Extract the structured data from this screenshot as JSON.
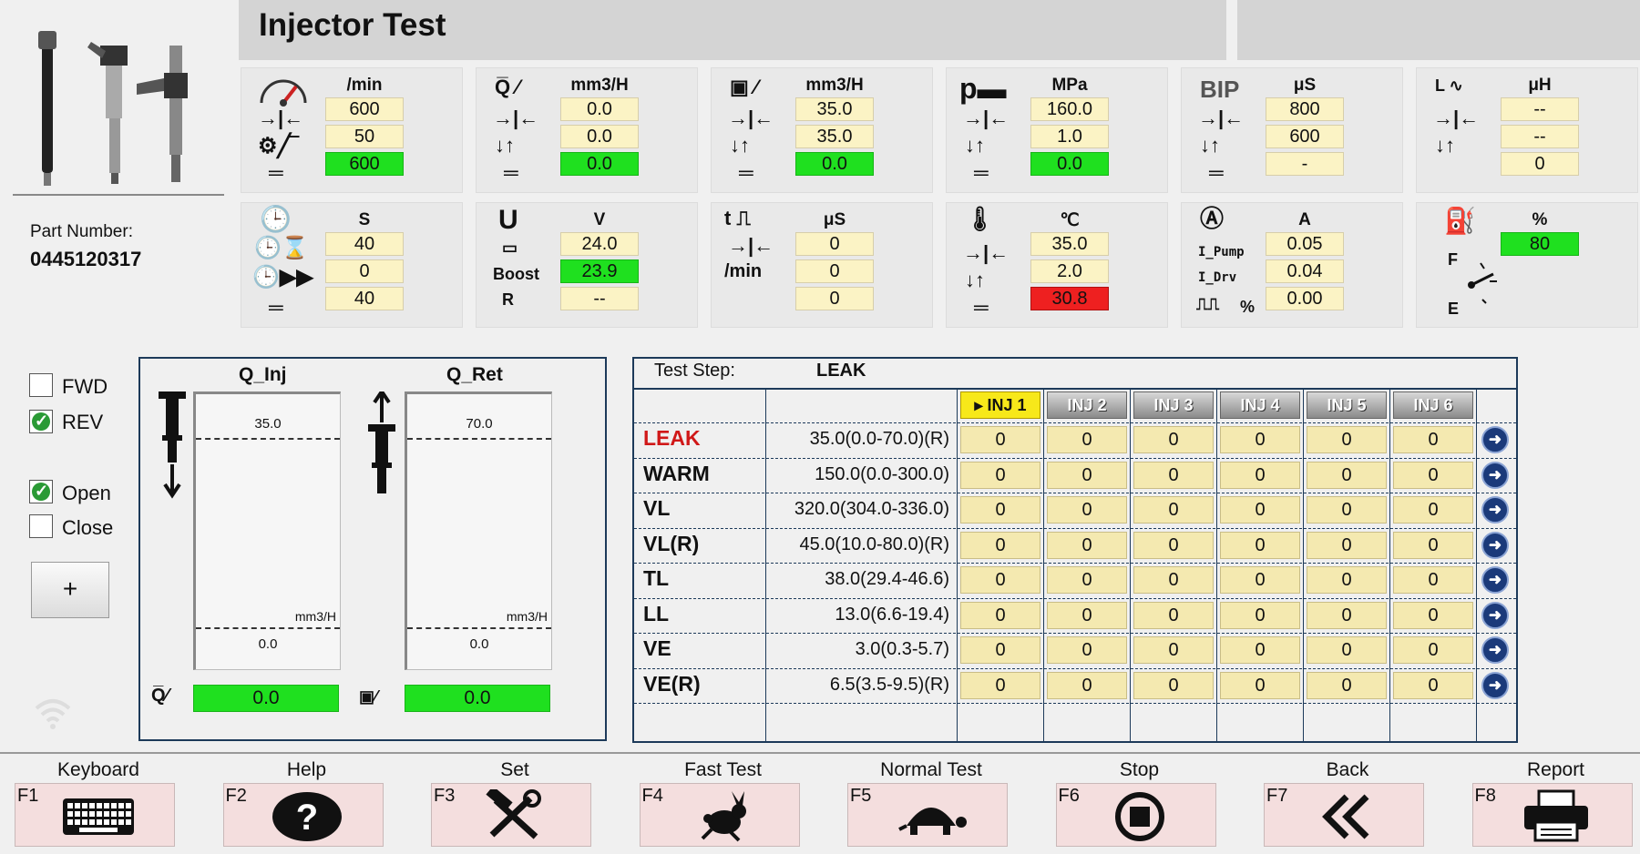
{
  "header": {
    "title": "Injector Test"
  },
  "part": {
    "label": "Part Number:",
    "value": "0445120317"
  },
  "panels": [
    {
      "id": "speed",
      "unit": "/min",
      "values": [
        "600",
        "50",
        "600"
      ],
      "styles": [
        "",
        "",
        "green"
      ]
    },
    {
      "id": "q-inj",
      "unit": "mm3/H",
      "values": [
        "0.0",
        "0.0",
        "0.0"
      ],
      "styles": [
        "",
        "",
        "green"
      ]
    },
    {
      "id": "q-ret",
      "unit": "mm3/H",
      "values": [
        "35.0",
        "35.0",
        "0.0"
      ],
      "styles": [
        "",
        "",
        "green"
      ]
    },
    {
      "id": "pressure",
      "unit": "MPa",
      "values": [
        "160.0",
        "1.0",
        "0.0"
      ],
      "styles": [
        "",
        "",
        "green"
      ]
    },
    {
      "id": "bip",
      "unit": "μS",
      "label": "BIP",
      "values": [
        "800",
        "600",
        "-"
      ],
      "styles": [
        "",
        "",
        ""
      ]
    },
    {
      "id": "inductance",
      "unit": "μH",
      "values": [
        "--",
        "--",
        "0"
      ],
      "styles": [
        "",
        "",
        ""
      ]
    },
    {
      "id": "time",
      "unit": "S",
      "values": [
        "40",
        "0",
        "40"
      ],
      "styles": [
        "",
        "",
        ""
      ]
    },
    {
      "id": "voltage",
      "unit": "V",
      "labels": [
        "Boost",
        "R"
      ],
      "values": [
        "24.0",
        "23.9",
        "--"
      ],
      "styles": [
        "",
        "green",
        ""
      ]
    },
    {
      "id": "pulse",
      "unit": "μS",
      "label": "/min",
      "values": [
        "0",
        "0",
        "0"
      ],
      "styles": [
        "",
        "",
        ""
      ]
    },
    {
      "id": "temperature",
      "unit": "℃",
      "values": [
        "35.0",
        "2.0",
        "30.8"
      ],
      "styles": [
        "",
        "",
        "red"
      ]
    },
    {
      "id": "current",
      "unit": "A",
      "labels": [
        "I_Pump",
        "I_Drv",
        "%"
      ],
      "values": [
        "0.05",
        "0.04",
        "0.00"
      ],
      "styles": [
        "",
        "",
        ""
      ]
    },
    {
      "id": "fuel",
      "unit": "%",
      "labels": [
        "F",
        "E"
      ],
      "values": [
        "80"
      ],
      "styles": [
        "green"
      ]
    }
  ],
  "controls": {
    "fwd_label": "FWD",
    "rev_label": "REV",
    "open_label": "Open",
    "close_label": "Close",
    "plus_label": "+"
  },
  "gauges": {
    "inj": {
      "title": "Q_Inj",
      "max": "35.0",
      "min": "0.0",
      "unit": "mm3/H",
      "value": "0.0"
    },
    "ret": {
      "title": "Q_Ret",
      "max": "70.0",
      "min": "0.0",
      "unit": "mm3/H",
      "value": "0.0"
    }
  },
  "table": {
    "step_label": "Test Step:",
    "step_value": "LEAK",
    "inj_headers": [
      "INJ 1",
      "INJ 2",
      "INJ 3",
      "INJ 4",
      "INJ 5",
      "INJ 6"
    ],
    "rows": [
      {
        "name": "LEAK",
        "spec": "35.0(0.0-70.0)(R)",
        "values": [
          "0",
          "0",
          "0",
          "0",
          "0",
          "0"
        ]
      },
      {
        "name": "WARM",
        "spec": "150.0(0.0-300.0)",
        "values": [
          "0",
          "0",
          "0",
          "0",
          "0",
          "0"
        ]
      },
      {
        "name": "VL",
        "spec": "320.0(304.0-336.0)",
        "values": [
          "0",
          "0",
          "0",
          "0",
          "0",
          "0"
        ]
      },
      {
        "name": "VL(R)",
        "spec": "45.0(10.0-80.0)(R)",
        "values": [
          "0",
          "0",
          "0",
          "0",
          "0",
          "0"
        ]
      },
      {
        "name": "TL",
        "spec": "38.0(29.4-46.6)",
        "values": [
          "0",
          "0",
          "0",
          "0",
          "0",
          "0"
        ]
      },
      {
        "name": "LL",
        "spec": "13.0(6.6-19.4)",
        "values": [
          "0",
          "0",
          "0",
          "0",
          "0",
          "0"
        ]
      },
      {
        "name": "VE",
        "spec": "3.0(0.3-5.7)",
        "values": [
          "0",
          "0",
          "0",
          "0",
          "0",
          "0"
        ]
      },
      {
        "name": "VE(R)",
        "spec": "6.5(3.5-9.5)(R)",
        "values": [
          "0",
          "0",
          "0",
          "0",
          "0",
          "0"
        ]
      }
    ]
  },
  "fkeys": [
    {
      "key": "F1",
      "label": "Keyboard",
      "icon": "keyboard-icon"
    },
    {
      "key": "F2",
      "label": "Help",
      "icon": "help-icon"
    },
    {
      "key": "F3",
      "label": "Set",
      "icon": "tools-icon"
    },
    {
      "key": "F4",
      "label": "Fast Test",
      "icon": "rabbit-icon"
    },
    {
      "key": "F5",
      "label": "Normal Test",
      "icon": "turtle-icon"
    },
    {
      "key": "F6",
      "label": "Stop",
      "icon": "stop-icon"
    },
    {
      "key": "F7",
      "label": "Back",
      "icon": "back-icon"
    },
    {
      "key": "F8",
      "label": "Report",
      "icon": "printer-icon"
    }
  ]
}
